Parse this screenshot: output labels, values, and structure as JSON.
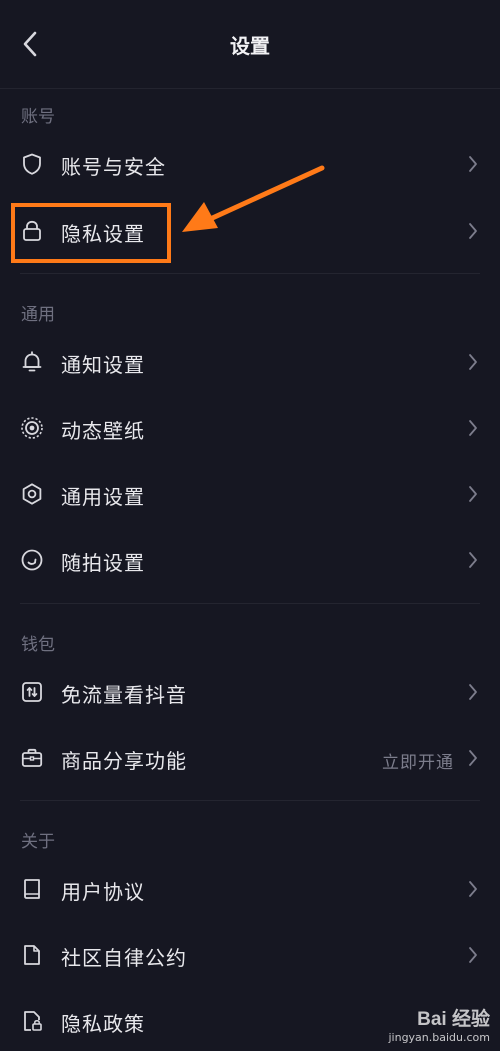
{
  "header": {
    "title": "设置"
  },
  "sections": [
    {
      "label": "账号"
    },
    {
      "label": "通用"
    },
    {
      "label": "钱包"
    },
    {
      "label": "关于"
    }
  ],
  "items": [
    {
      "label": "账号与安全",
      "icon": "shield-icon"
    },
    {
      "label": "隐私设置",
      "icon": "lock-icon"
    },
    {
      "label": "通知设置",
      "icon": "bell-icon"
    },
    {
      "label": "动态壁纸",
      "icon": "live-wallpaper-icon"
    },
    {
      "label": "通用设置",
      "icon": "gear-icon"
    },
    {
      "label": "随拍设置",
      "icon": "camera-circle-icon"
    },
    {
      "label": "免流量看抖音",
      "icon": "data-free-icon"
    },
    {
      "label": "商品分享功能",
      "icon": "briefcase-icon",
      "extra": "立即开通"
    },
    {
      "label": "用户协议",
      "icon": "book-icon"
    },
    {
      "label": "社区自律公约",
      "icon": "document-icon"
    },
    {
      "label": "隐私政策",
      "icon": "document-lock-icon"
    }
  ],
  "annotation": {
    "color": "#ff7a18"
  },
  "watermark": {
    "brand": "Bai 经验",
    "url": "jingyan.baidu.com"
  }
}
